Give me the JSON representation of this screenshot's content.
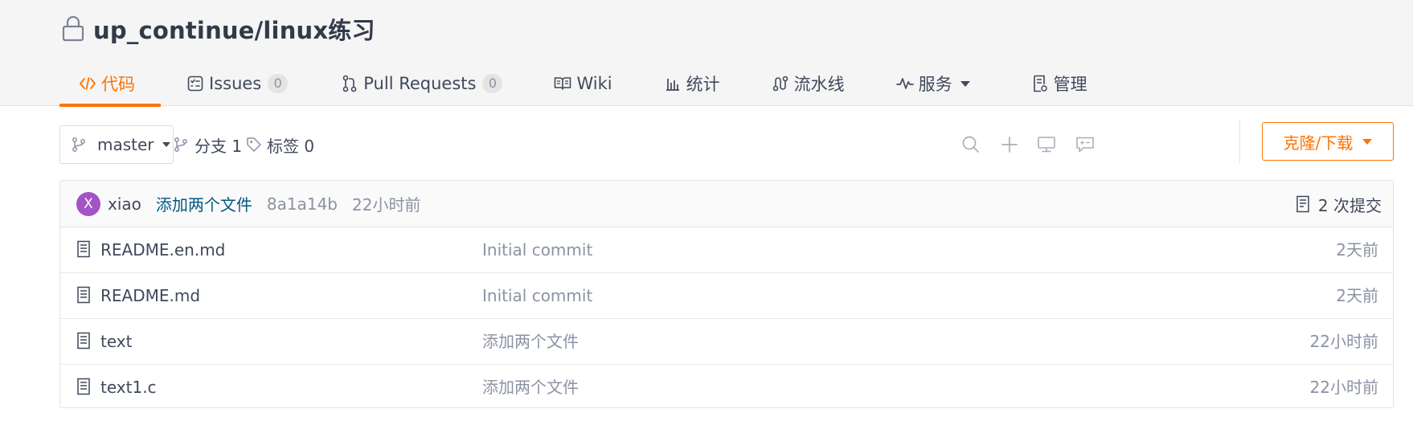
{
  "repo": {
    "title": "up_continue/linux练习",
    "icon": "lock-icon"
  },
  "tabs": [
    {
      "label": "代码",
      "icon": "code-icon",
      "active": true
    },
    {
      "label": "Issues",
      "icon": "issues-icon",
      "badge": "0"
    },
    {
      "label": "Pull Requests",
      "icon": "pull-request-icon",
      "badge": "0"
    },
    {
      "label": "Wiki",
      "icon": "book-icon"
    },
    {
      "label": "统计",
      "icon": "bar-chart-icon"
    },
    {
      "label": "流水线",
      "icon": "pipeline-icon"
    },
    {
      "label": "服务",
      "icon": "pulse-icon",
      "dropdown": true
    },
    {
      "label": "管理",
      "icon": "settings-doc-icon"
    }
  ],
  "toolbar": {
    "branch": "master",
    "branches_label": "分支 1",
    "tags_label": "标签 0",
    "clone_label": "克隆/下载"
  },
  "commit": {
    "avatar_letter": "X",
    "author": "xiao",
    "message": "添加两个文件",
    "hash": "8a1a14b",
    "time": "22小时前",
    "count_label": "2 次提交"
  },
  "files": [
    {
      "name": "README.en.md",
      "message": "Initial commit",
      "time": "2天前"
    },
    {
      "name": "README.md",
      "message": "Initial commit",
      "time": "2天前"
    },
    {
      "name": "text",
      "message": "添加两个文件",
      "time": "22小时前"
    },
    {
      "name": "text1.c",
      "message": "添加两个文件",
      "time": "22小时前"
    }
  ],
  "colors": {
    "accent": "#fe7300",
    "link": "#005980",
    "muted": "#8c92a4",
    "avatar": "#a453c4"
  }
}
